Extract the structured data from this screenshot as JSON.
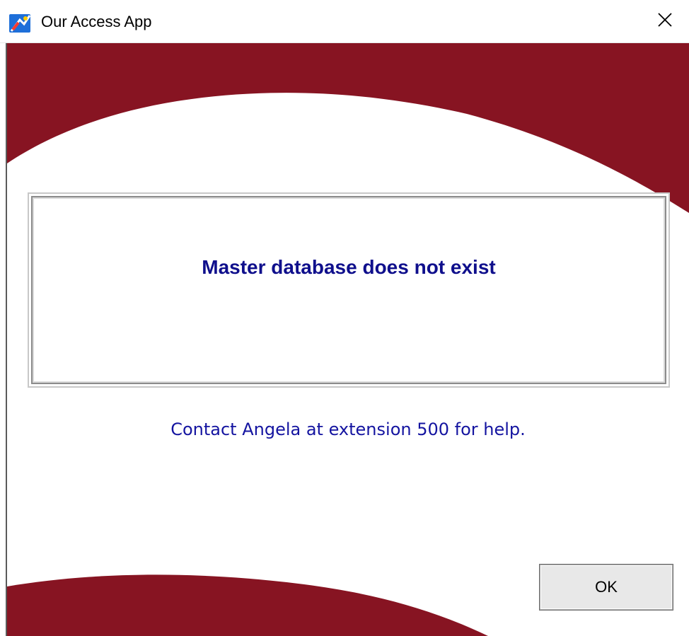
{
  "window": {
    "title": "Our Access App",
    "icon": "access-app-icon",
    "close_icon": "close-icon"
  },
  "colors": {
    "brand_maroon": "#871422",
    "message_text": "#0f0f8c",
    "help_text": "#1414a0"
  },
  "dialog": {
    "message": "Master database does not exist",
    "help": "Contact Angela at extension 500 for help.",
    "ok_label": "OK"
  }
}
